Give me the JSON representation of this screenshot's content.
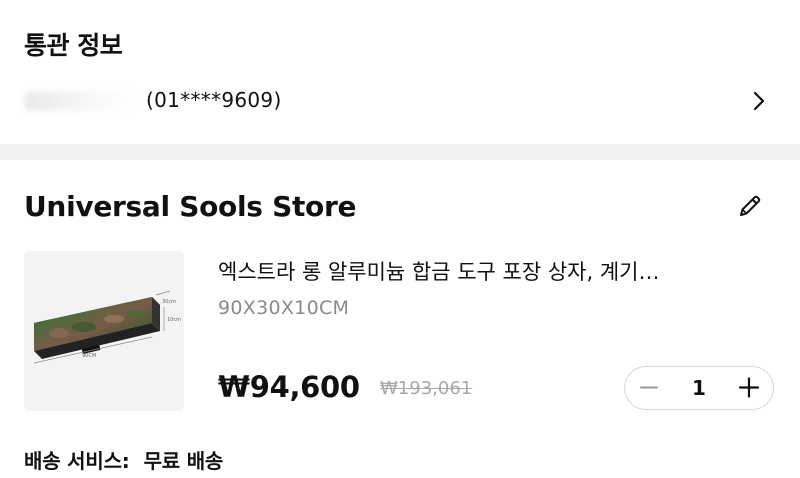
{
  "customs": {
    "title": "통관 정보",
    "masked_value": "(01****9609)"
  },
  "store": {
    "name": "Universal Sools Store"
  },
  "product": {
    "title": "엑스트라 롱 알루미늄 합금 도구 포장 상자, 계기…",
    "option": "90X30X10CM",
    "price": "₩94,600",
    "original_price": "₩193,061",
    "quantity": "1",
    "image_dims": {
      "width": "30cm",
      "depth": "10cm",
      "length": "90CM"
    }
  },
  "shipping": {
    "label": "배송 서비스:",
    "value": "무료 배송"
  },
  "colors": {
    "band": "#f2f2f2",
    "muted_text": "#8a8a8a",
    "strike_text": "#a8a8a8",
    "stepper_border": "#d7d7d7"
  },
  "icons": [
    "chevron-right-icon",
    "pencil-edit-icon",
    "minus-icon",
    "plus-icon"
  ]
}
